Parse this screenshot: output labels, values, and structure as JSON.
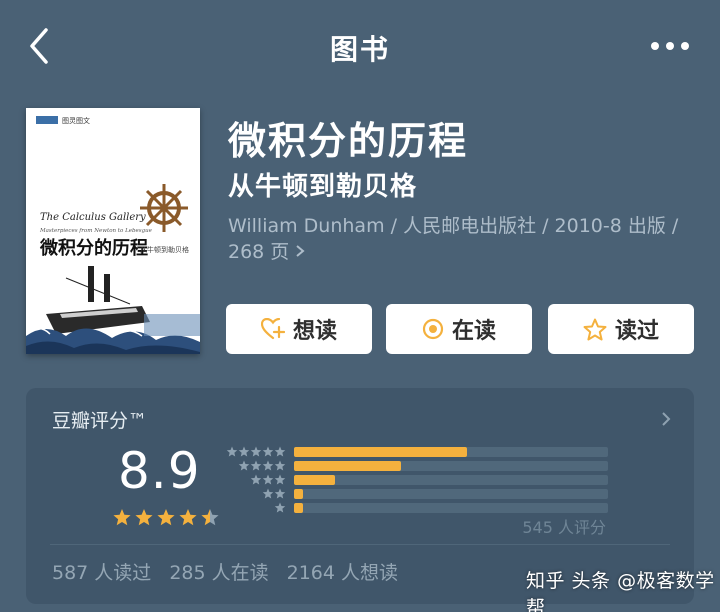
{
  "nav": {
    "title": "图书",
    "back_icon": "chevron-left-icon",
    "more_icon": "more-dots-icon"
  },
  "book": {
    "title": "微积分的历程",
    "subtitle": "从牛顿到勒贝格",
    "meta_line1": "William Dunham / 人民邮电出版社 / 2010-8 出版 /",
    "meta_line2": "268 页",
    "cover": {
      "publisher_tag": "图灵图文",
      "english_title": "The Calculus Gallery",
      "english_subtitle": "Masterpieces from Newton to Lebesgue",
      "chinese_title": "微积分的历程",
      "chinese_subtitle": "从牛顿到勒贝格",
      "wheel_icon": "ship-wheel-icon",
      "ship_icon": "steamship-icon"
    }
  },
  "actions": {
    "want": {
      "label": "想读",
      "icon": "heart-plus-icon"
    },
    "reading": {
      "label": "在读",
      "icon": "circle-dot-icon"
    },
    "read": {
      "label": "读过",
      "icon": "star-outline-icon"
    }
  },
  "rating": {
    "title": "豆瓣评分™",
    "score": "8.9",
    "stars": 4.5,
    "count_text": "545 人评分",
    "distribution": [
      {
        "stars": 5,
        "fraction": 0.55
      },
      {
        "stars": 4,
        "fraction": 0.34
      },
      {
        "stars": 3,
        "fraction": 0.13
      },
      {
        "stars": 2,
        "fraction": 0.03
      },
      {
        "stars": 1,
        "fraction": 0.03
      }
    ],
    "colors": {
      "accent": "#f4b13e",
      "track": "#50687b"
    }
  },
  "stats": {
    "read": "587 人读过",
    "reading": "285 人在读",
    "want": "2164 人想读"
  },
  "watermark": "知乎 头条 @极客数学帮"
}
